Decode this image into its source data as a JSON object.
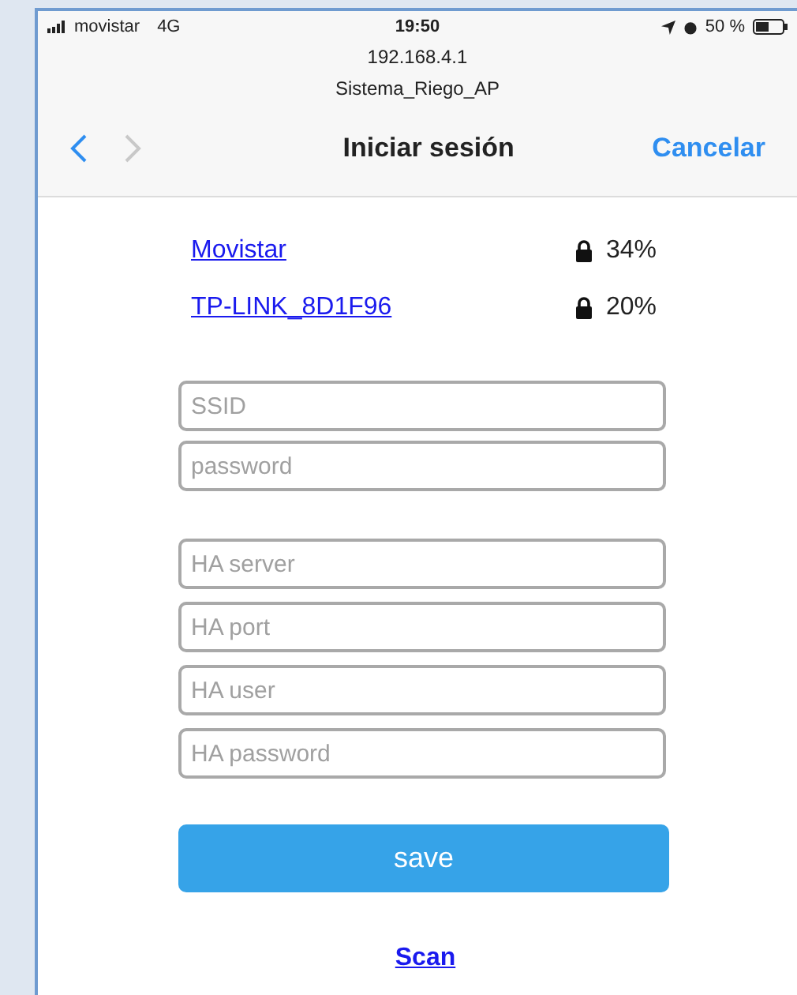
{
  "status_bar": {
    "carrier": "movistar",
    "network": "4G",
    "time": "19:50",
    "battery": "50 %"
  },
  "header": {
    "address": "192.168.4.1",
    "network_name": "Sistema_Riego_AP"
  },
  "nav": {
    "back_disabled": false,
    "forward_disabled": true,
    "title": "Iniciar sesión",
    "cancel": "Cancelar"
  },
  "networks": [
    {
      "name": "Movistar",
      "signal": "34%"
    },
    {
      "name": "TP-LINK_8D1F96",
      "signal": "20%"
    }
  ],
  "wifi_fields": [
    {
      "placeholder": "SSID"
    },
    {
      "placeholder": "password"
    }
  ],
  "ha_fields": [
    {
      "placeholder": "HA server"
    },
    {
      "placeholder": "HA port"
    },
    {
      "placeholder": "HA user"
    },
    {
      "placeholder": "HA password"
    }
  ],
  "save_button": "save",
  "scan_link": "Scan"
}
